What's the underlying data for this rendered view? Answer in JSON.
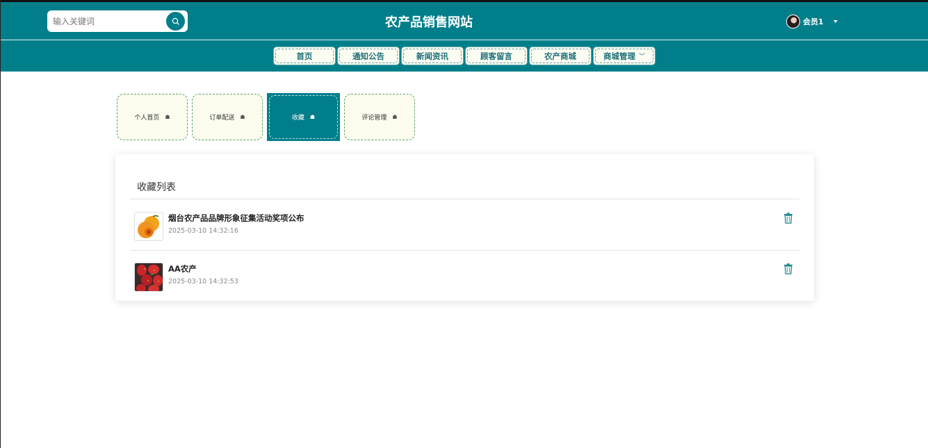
{
  "header": {
    "site_title": "农产品销售网站",
    "search_placeholder": "输入关键词",
    "user_name": "会员1"
  },
  "nav": {
    "items": [
      "首页",
      "通知公告",
      "新闻资讯",
      "顾客留言",
      "农产商城",
      "商城管理"
    ]
  },
  "tabs": {
    "items": [
      "个人首页",
      "订单配送",
      "收藏",
      "评论管理"
    ],
    "active": "收藏"
  },
  "favorites": {
    "title": "收藏列表",
    "items": [
      {
        "name": "烟台农产品品牌形象征集活动奖项公布",
        "time": "2025-03-10 14:32:16",
        "thumb": "apricot"
      },
      {
        "name": "AA农产",
        "time": "2025-03-10 14:32:53",
        "thumb": "strawberry"
      }
    ]
  },
  "colors": {
    "primary": "#007f8b",
    "tab_bg": "#fbfcee"
  },
  "icons": {
    "search": "search-icon",
    "tab": "home-icon",
    "delete": "trash-icon",
    "caret": "caret-down-icon"
  }
}
